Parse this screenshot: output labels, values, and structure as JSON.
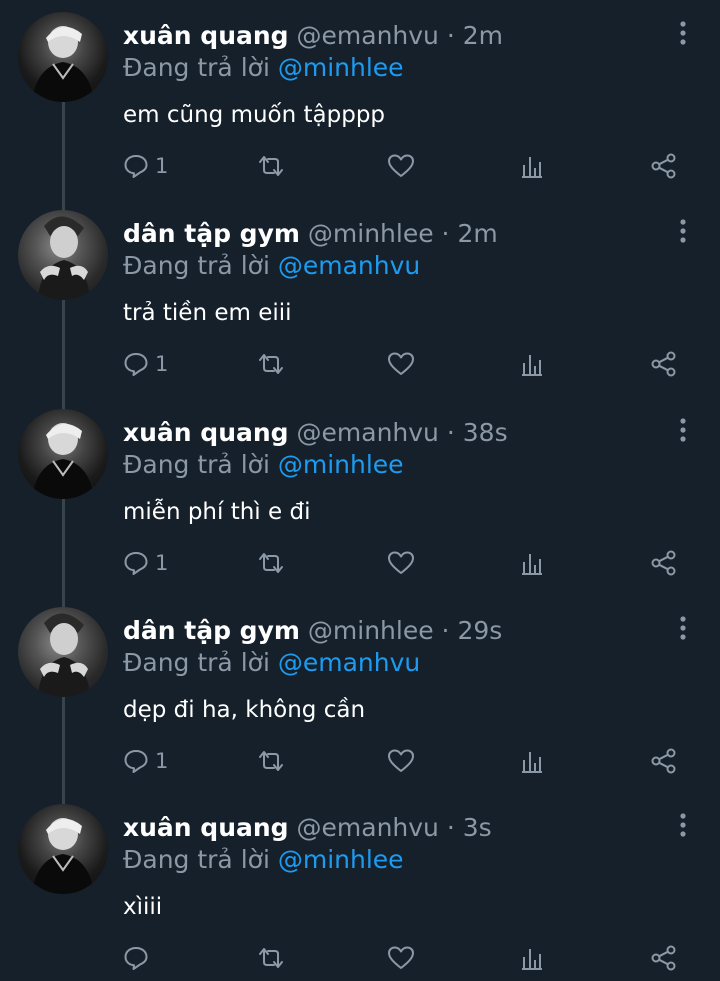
{
  "labels": {
    "replying_prefix": "Đang trả lời"
  },
  "colors": {
    "background": "#15202b",
    "text": "#ffffff",
    "muted": "#8b98a5",
    "link": "#1d9bf0",
    "thread_line": "#38444d"
  },
  "tweets": [
    {
      "name": "xuân quang",
      "handle": "@emanhvu",
      "time": "2m",
      "mention": "@minhlee",
      "text": "em cũng muốn tậpppp",
      "reply_count": "1"
    },
    {
      "name": "dân tập gym",
      "handle": "@minhlee",
      "time": "2m",
      "mention": "@emanhvu",
      "text": "trả tiền em eiii",
      "reply_count": "1"
    },
    {
      "name": "xuân quang",
      "handle": "@emanhvu",
      "time": "38s",
      "mention": "@minhlee",
      "text": "miễn phí thì e đi",
      "reply_count": "1"
    },
    {
      "name": "dân tập gym",
      "handle": "@minhlee",
      "time": "29s",
      "mention": "@emanhvu",
      "text": "dẹp đi ha, không cần",
      "reply_count": "1"
    },
    {
      "name": "xuân quang",
      "handle": "@emanhvu",
      "time": "3s",
      "mention": "@minhlee",
      "text": "xìiii",
      "reply_count": ""
    }
  ],
  "icons": [
    "reply-icon",
    "retweet-icon",
    "like-icon",
    "analytics-icon",
    "share-icon",
    "more-options-icon"
  ]
}
